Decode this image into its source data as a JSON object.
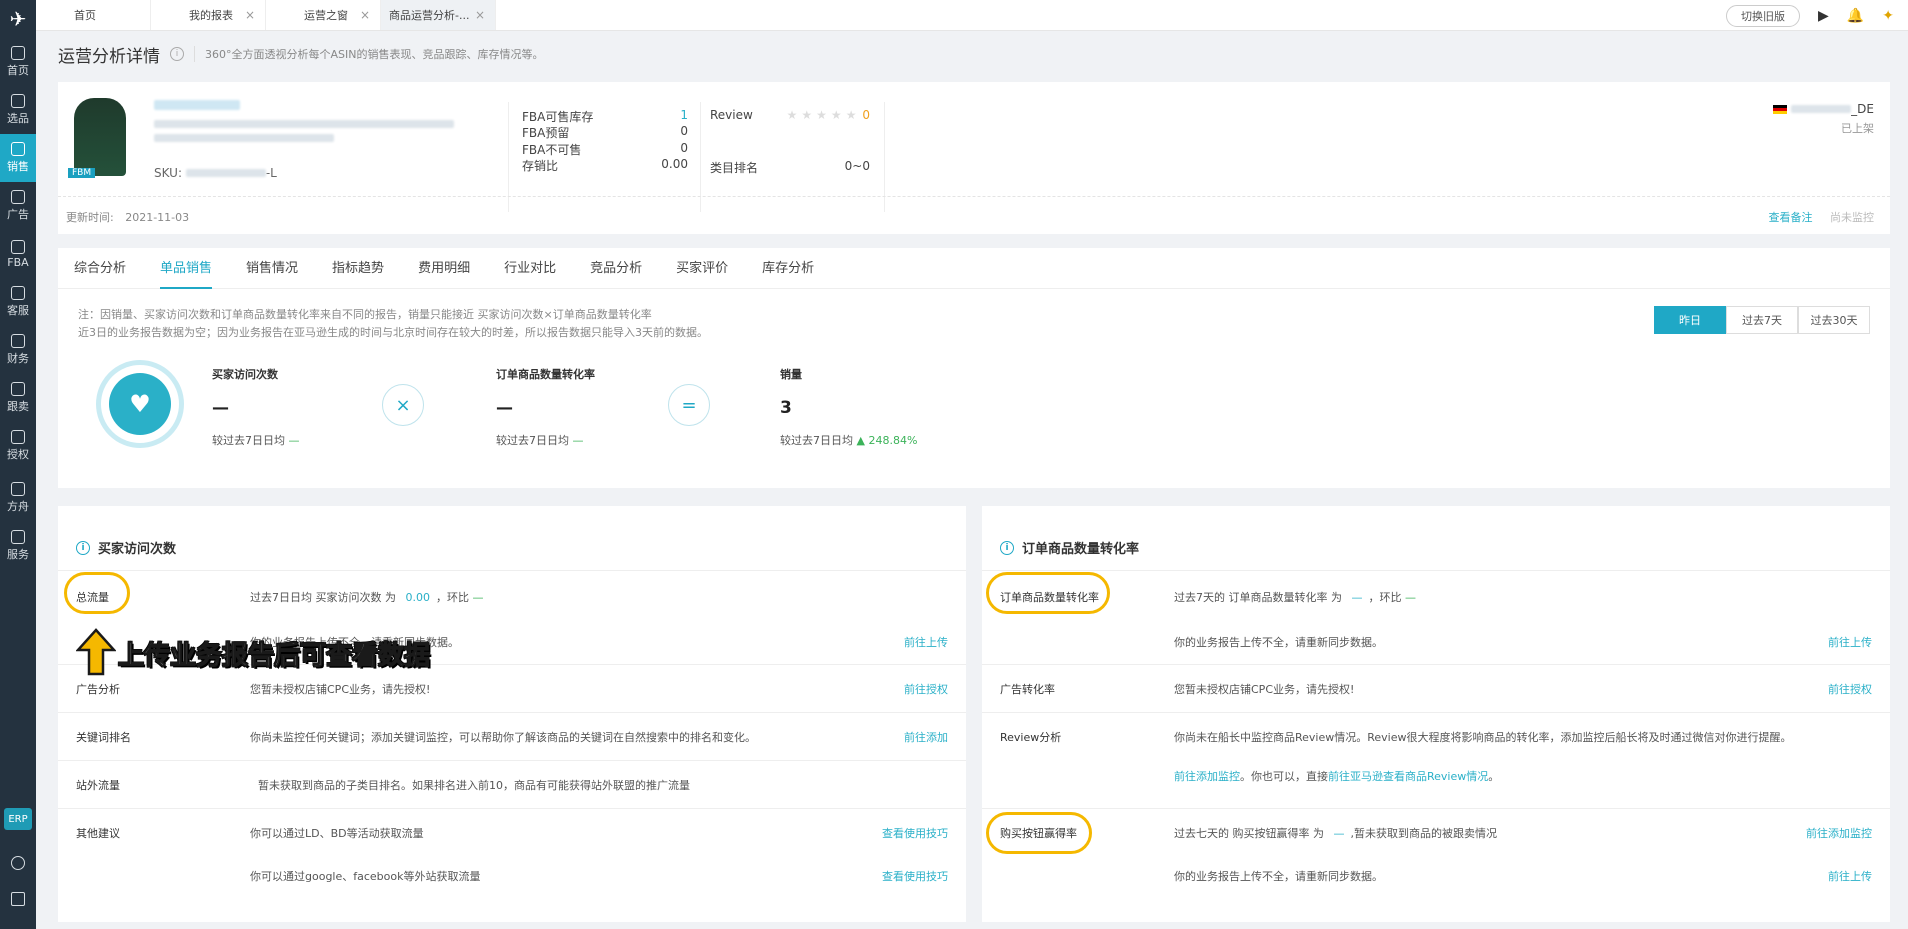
{
  "sidebar": {
    "items": [
      {
        "label": "首页",
        "icon": "home-icon"
      },
      {
        "label": "选品",
        "icon": "search-icon"
      },
      {
        "label": "销售",
        "icon": "chart-icon"
      },
      {
        "label": "广告",
        "icon": "ad-icon"
      },
      {
        "label": "FBA",
        "icon": "box-icon"
      },
      {
        "label": "客服",
        "icon": "service-icon"
      },
      {
        "label": "财务",
        "icon": "finance-icon"
      },
      {
        "label": "跟卖",
        "icon": "pie-icon"
      },
      {
        "label": "授权",
        "icon": "shield-icon"
      },
      {
        "label": "方舟",
        "icon": "ark-icon"
      },
      {
        "label": "服务",
        "icon": "store-icon"
      }
    ],
    "erp": "ERP"
  },
  "tabs": [
    {
      "label": "首页"
    },
    {
      "label": "我的报表"
    },
    {
      "label": "运营之窗"
    },
    {
      "label": "商品运营分析-..."
    }
  ],
  "top": {
    "switch_label": "切换旧版"
  },
  "page": {
    "title": "运营分析详情",
    "desc": "360°全方面透视分析每个ASIN的销售表现、竞品跟踪、库存情况等。"
  },
  "product": {
    "fbm": "FBM",
    "sku_label": "SKU:",
    "sku_suffix": "-L",
    "update_label": "更新时间:",
    "update_date": "2021-11-03",
    "market_suffix": "_DE",
    "status": "已上架",
    "note_link": "查看备注",
    "monitor": "尚未监控",
    "stock": [
      {
        "k": "FBA可售库存",
        "v": "1"
      },
      {
        "k": "FBA预留",
        "v": "0"
      },
      {
        "k": "FBA不可售",
        "v": "0"
      },
      {
        "k": "存销比",
        "v": "0.00"
      }
    ],
    "review_label": "Review",
    "review_stars": "★★★★★",
    "review_count": "0",
    "rank_label": "类目排名",
    "rank_value": "0~0"
  },
  "subtabs": [
    "综合分析",
    "单品销售",
    "销售情况",
    "指标趋势",
    "费用明细",
    "行业对比",
    "竞品分析",
    "买家评价",
    "库存分析"
  ],
  "notes": [
    "注：因销量、买家访问次数和订单商品数量转化率来自不同的报告，销量只能接近 买家访问次数×订单商品数量转化率",
    "近3日的业务报告数据为空；因为业务报告在亚马逊生成的时间与北京时间存在较大的时差，所以报告数据只能导入3天前的数据。"
  ],
  "periods": [
    "昨日",
    "过去7天",
    "过去30天"
  ],
  "metrics": [
    {
      "label": "买家访问次数",
      "value": "—",
      "cmp": "较过去7日日均",
      "delta": "—"
    },
    {
      "label": "订单商品数量转化率",
      "value": "—",
      "cmp": "较过去7日日均",
      "delta": "—"
    },
    {
      "label": "销量",
      "value": "3",
      "cmp": "较过去7日日均",
      "delta": "248.84%"
    }
  ],
  "ops": {
    "times": "×",
    "equals": "="
  },
  "left": {
    "title": "买家访问次数",
    "rows": [
      {
        "label": "总流量",
        "text": "过去7日日均 买家访问次数 为",
        "val": "0.00",
        "text2": "，环比",
        "delta": "—",
        "action": ""
      },
      {
        "label": "",
        "text": "你的业务报告上传不全，请重新同步数据。",
        "action": "前往上传"
      },
      {
        "label": "广告分析",
        "text": "您暂未授权店铺CPC业务，请先授权!",
        "action": "前往授权"
      },
      {
        "label": "关键词排名",
        "text": "你尚未监控任何关键词；添加关键词监控，可以帮助你了解该商品的关键词在自然搜索中的排名和变化。",
        "action": "前往添加"
      },
      {
        "label": "站外流量",
        "text": "暂未获取到商品的子类目排名。如果排名进入前10，商品有可能获得站外联盟的推广流量",
        "action": ""
      },
      {
        "label": "其他建议",
        "text": "你可以通过LD、BD等活动获取流量",
        "action": "查看使用技巧"
      },
      {
        "label": "",
        "text": "你可以通过google、facebook等外站获取流量",
        "action": "查看使用技巧"
      }
    ]
  },
  "right": {
    "title": "订单商品数量转化率",
    "rows": [
      {
        "label": "订单商品数量转化率",
        "text": "过去7天的 订单商品数量转化率 为",
        "val": "—",
        "text2": "，环比",
        "delta": "—",
        "action": ""
      },
      {
        "label": "",
        "text": "你的业务报告上传不全，请重新同步数据。",
        "action": "前往上传"
      },
      {
        "label": "广告转化率",
        "text": "您暂未授权店铺CPC业务，请先授权!",
        "action": "前往授权"
      },
      {
        "label": "Review分析",
        "text": "你尚未在船长中监控商品Review情况。Review很大程度将影响商品的转化率，添加监控后船长将及时通过微信对你进行提醒。",
        "action": ""
      },
      {
        "label": "",
        "link1": "前往添加监控",
        "text": "。你也可以，直接",
        "link2": "前往亚马逊查看商品Review情况",
        "text3": "。",
        "action": ""
      },
      {
        "label": "购买按钮赢得率",
        "text": "过去七天的 购买按钮赢得率 为",
        "val": "—",
        "text2": ",暂未获取到商品的被跟卖情况",
        "action": "前往添加监控"
      },
      {
        "label": "",
        "text": "你的业务报告上传不全，请重新同步数据。",
        "action": "前往上传"
      }
    ]
  },
  "overlay": "上传业务报告后可查看数据",
  "colors": {
    "accent": "#1fa8c6",
    "highlight": "#f5b800",
    "sidebar": "#24323f",
    "green": "#3cb35a"
  }
}
